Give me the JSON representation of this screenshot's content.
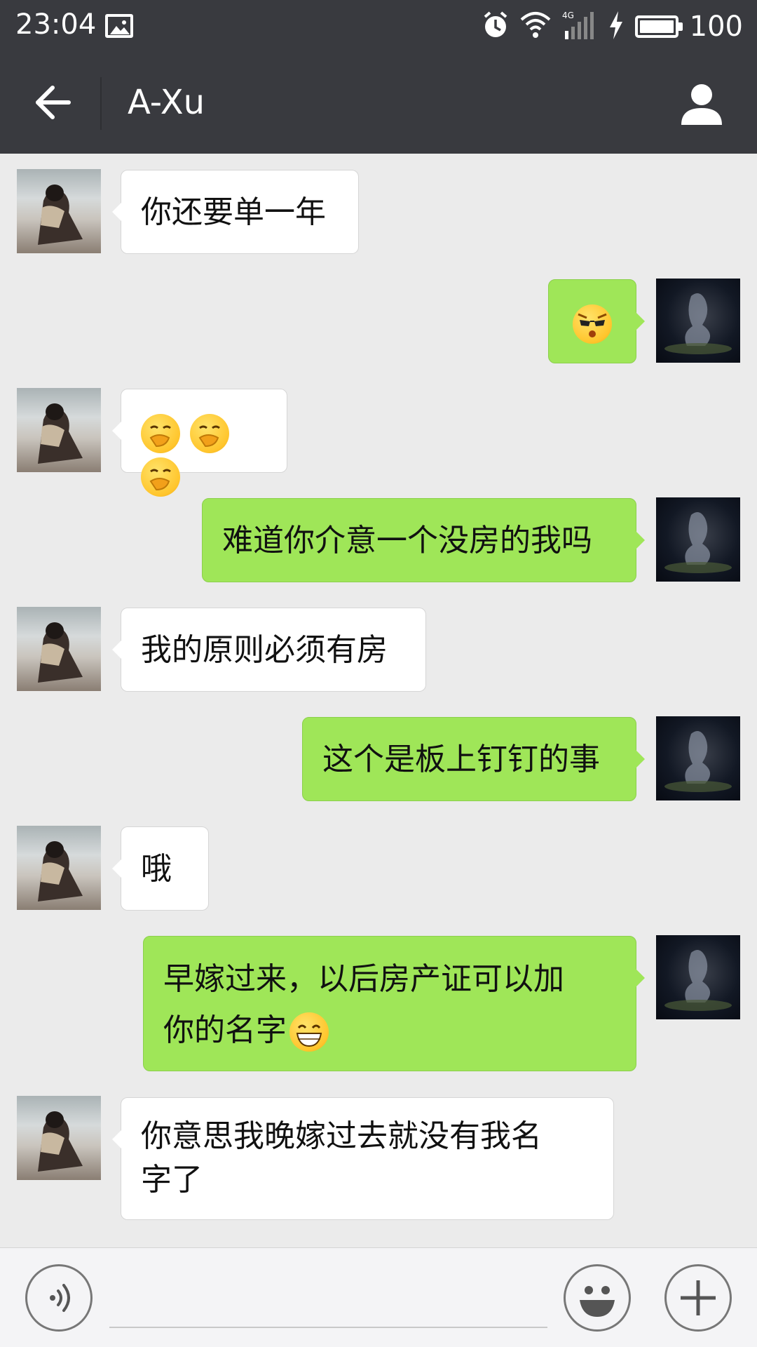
{
  "status_bar": {
    "time": "23:04",
    "network": "4G",
    "battery_level": "100",
    "icons": [
      "image-icon",
      "alarm-icon",
      "wifi-icon",
      "cell-signal-icon",
      "charging-icon",
      "battery-icon"
    ]
  },
  "header": {
    "title": "A-Xu",
    "back_icon": "back-arrow-icon",
    "profile_icon": "person-icon"
  },
  "colors": {
    "header_bg": "#393a3f",
    "chat_bg": "#ebebeb",
    "sent_bubble": "#9fe658",
    "received_bubble": "#ffffff"
  },
  "messages": [
    {
      "sender": "contact",
      "text": "你还要单一年"
    },
    {
      "sender": "me",
      "text": "",
      "emoji": "sunglasses-face-emoji"
    },
    {
      "sender": "contact",
      "text": "",
      "emoji": "hand-over-mouth-face-emoji x3"
    },
    {
      "sender": "me",
      "text": "难道你介意一个没房的我吗"
    },
    {
      "sender": "contact",
      "text": "我的原则必须有房"
    },
    {
      "sender": "me",
      "text": "这个是板上钉钉的事"
    },
    {
      "sender": "contact",
      "text": "哦"
    },
    {
      "sender": "me",
      "text_line1": "早嫁过来，以后房产证可以加",
      "text_line2": "你的名字",
      "emoji": "grinning-face-emoji"
    },
    {
      "sender": "contact",
      "text_line1": "你意思我晚嫁过去就没有我名",
      "text_line2": "字了"
    }
  ],
  "input_bar": {
    "placeholder": "",
    "icons": [
      "voice-icon",
      "emoji-icon",
      "plus-icon"
    ]
  }
}
